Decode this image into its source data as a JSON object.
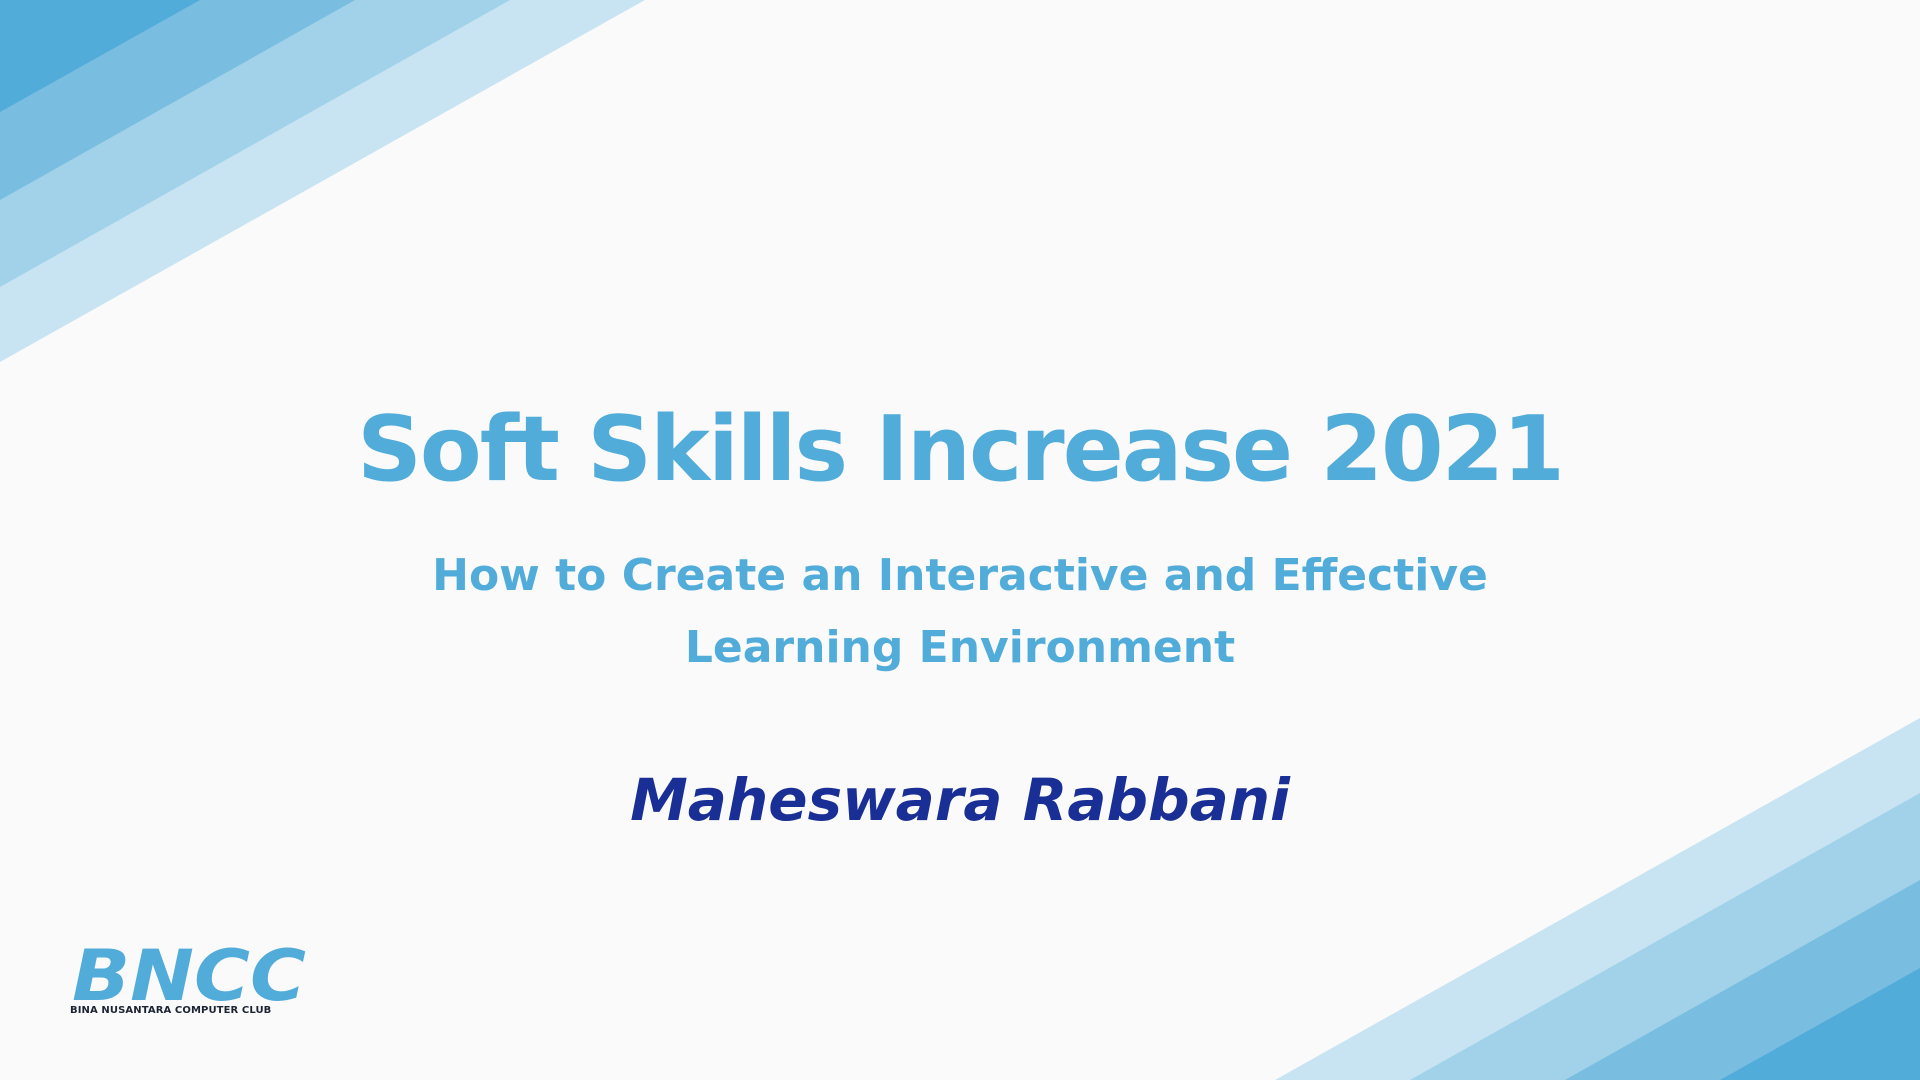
{
  "slide": {
    "title": "Soft Skills Increase 2021",
    "subtitle_lines": [
      "How to Create an Interactive and Effective",
      "Learning Environment"
    ],
    "author": "Maheswara Rabbani"
  },
  "logo": {
    "mark": "BNCC",
    "tagline": "BINA NUSANTARA COMPUTER CLUB"
  },
  "colors": {
    "background": "#fafafa",
    "accent_blue": "#51acd9",
    "author_navy": "#1a2f95",
    "stripe_1": "#51acd9",
    "stripe_2": "#79bde0",
    "stripe_3": "#a1d2e9",
    "stripe_4": "#c8e4f2"
  }
}
